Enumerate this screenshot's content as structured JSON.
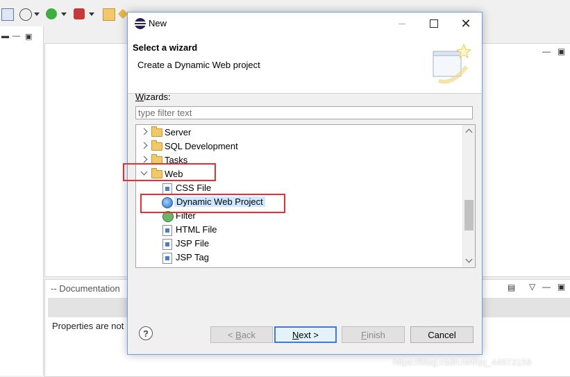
{
  "background": {
    "documentation_tab": "-- Documentation",
    "properties_text": "Properties are not"
  },
  "dialog": {
    "title": "New",
    "banner_title": "Select a wizard",
    "banner_subtitle": "Create a Dynamic Web project",
    "wizards_label": "Wizards:",
    "filter_placeholder": "type filter text",
    "tree": [
      {
        "label": "Server",
        "kind": "folder",
        "expanded": false
      },
      {
        "label": "SQL Development",
        "kind": "folder",
        "expanded": false
      },
      {
        "label": "Tasks",
        "kind": "folder",
        "expanded": false
      },
      {
        "label": "Web",
        "kind": "folder",
        "expanded": true
      },
      {
        "label": "CSS File",
        "kind": "file"
      },
      {
        "label": "Dynamic Web Project",
        "kind": "project",
        "selected": true
      },
      {
        "label": "Filter",
        "kind": "filter"
      },
      {
        "label": "HTML File",
        "kind": "file"
      },
      {
        "label": "JSP File",
        "kind": "file"
      },
      {
        "label": "JSP Tag",
        "kind": "file"
      }
    ],
    "buttons": {
      "help": "?",
      "back": "< Back",
      "next": "Next >",
      "finish": "Finish",
      "cancel": "Cancel"
    }
  },
  "watermark": "https://blog.csdn.net/qq_44973159",
  "colors": {
    "highlight": "#e62f2f",
    "selection": "#cde8ff",
    "default_button_border": "#3b7bdb"
  }
}
